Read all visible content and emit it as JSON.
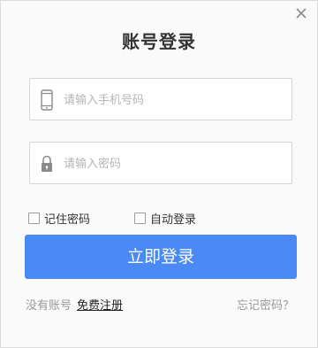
{
  "dialog": {
    "title": "账号登录",
    "close_icon": "close-icon"
  },
  "phone": {
    "icon": "phone-icon",
    "placeholder": "请输入手机号码",
    "value": ""
  },
  "password": {
    "icon": "lock-icon",
    "placeholder": "请输入密码",
    "value": ""
  },
  "options": {
    "remember_label": "记住密码",
    "remember_checked": false,
    "auto_login_label": "自动登录",
    "auto_login_checked": false
  },
  "login_button": {
    "label": "立即登录",
    "color": "#4a8af4"
  },
  "footer": {
    "no_account_text": "没有账号",
    "register_label": "免费注册",
    "forgot_label": "忘记密码？"
  }
}
